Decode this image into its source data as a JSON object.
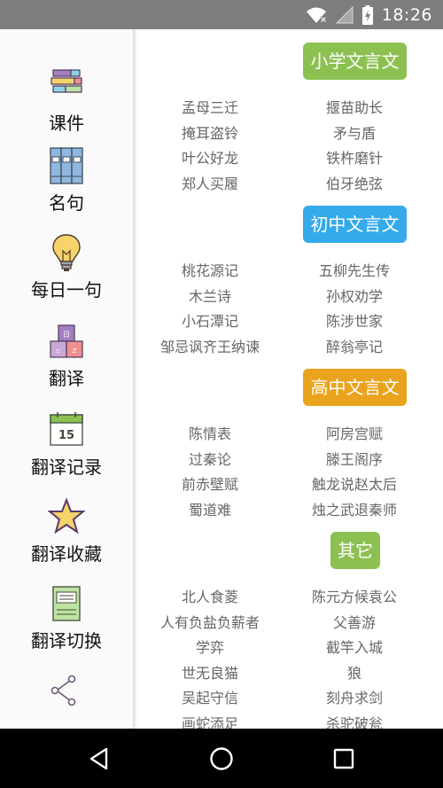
{
  "status_bar": {
    "time": "18:26",
    "icons": [
      "wifi-icon",
      "signal-icon",
      "battery-charging-icon"
    ]
  },
  "sidebar": {
    "items": [
      {
        "label": "课件",
        "icon": "courseware-icon"
      },
      {
        "label": "名句",
        "icon": "books-icon"
      },
      {
        "label": "每日一句",
        "icon": "lightbulb-icon"
      },
      {
        "label": "翻译",
        "icon": "translate-blocks-icon"
      },
      {
        "label": "翻译记录",
        "icon": "calendar-icon",
        "calendar_day": "15"
      },
      {
        "label": "翻译收藏",
        "icon": "star-icon"
      },
      {
        "label": "翻译切换",
        "icon": "notebook-icon"
      },
      {
        "label": "",
        "icon": "share-icon"
      }
    ]
  },
  "sections": [
    {
      "title": "小学文言文",
      "color": "#8cc152",
      "items": [
        "孟母三迁",
        "揠苗助长",
        "掩耳盗铃",
        "矛与盾",
        "叶公好龙",
        "铁杵磨针",
        "郑人买履",
        "伯牙绝弦"
      ]
    },
    {
      "title": "初中文言文",
      "color": "#35aaeb",
      "items": [
        "桃花源记",
        "五柳先生传",
        "木兰诗",
        "孙权劝学",
        "小石潭记",
        "陈涉世家",
        "邹忌讽齐王纳谏",
        "醉翁亭记"
      ]
    },
    {
      "title": "高中文言文",
      "color": "#eaa31e",
      "items": [
        "陈情表",
        "阿房宫赋",
        "过秦论",
        "滕王阁序",
        "前赤壁赋",
        "触龙说赵太后",
        "蜀道难",
        "烛之武退秦师"
      ]
    },
    {
      "title": "其它",
      "color": "#8cc152",
      "items": [
        "北人食菱",
        "陈元方候袁公",
        "人有负盐负薪者",
        "父善游",
        "学弈",
        "截竿入城",
        "世无良猫",
        "狼",
        "吴起守信",
        "刻舟求剑",
        "画蛇添足",
        "杀驼破瓮"
      ]
    }
  ],
  "nav_bar": {
    "buttons": [
      "back-icon",
      "home-icon",
      "recents-icon"
    ]
  }
}
